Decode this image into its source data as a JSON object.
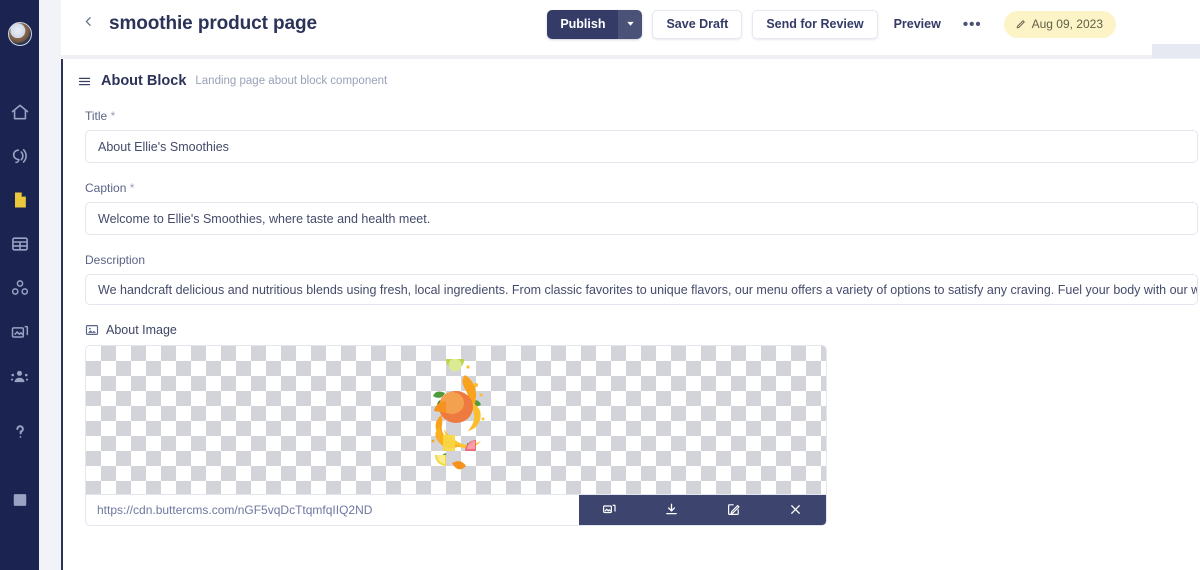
{
  "sidebar": {
    "avatar": {
      "name": "user-avatar"
    },
    "items": [
      {
        "icon": "home-icon",
        "name": "sidebar-item-home",
        "active": false
      },
      {
        "icon": "megaphone-icon",
        "name": "sidebar-item-broadcast",
        "active": false
      },
      {
        "icon": "page-icon",
        "name": "sidebar-item-pages",
        "active": true
      },
      {
        "icon": "table-icon",
        "name": "sidebar-item-collections",
        "active": false
      },
      {
        "icon": "components-icon",
        "name": "sidebar-item-components",
        "active": false
      },
      {
        "icon": "media-icon",
        "name": "sidebar-item-media",
        "active": false
      },
      {
        "icon": "team-icon",
        "name": "sidebar-item-team",
        "active": false
      }
    ],
    "bottom_items": [
      {
        "icon": "help-icon",
        "name": "sidebar-item-help"
      },
      {
        "icon": "book-icon",
        "name": "sidebar-item-docs"
      }
    ]
  },
  "header": {
    "back_label": "‹",
    "title": "smoothie product page",
    "publish_label": "Publish",
    "publish_caret": "▾",
    "save_draft_label": "Save Draft",
    "send_for_review_label": "Send for Review",
    "preview_label": "Preview",
    "more_label": "•••",
    "date_badge": "Aug 09, 2023"
  },
  "block": {
    "title": "About Block",
    "subtitle": "Landing page about block component",
    "fields": {
      "title": {
        "label": "Title",
        "required": "*",
        "value": "About Ellie's Smoothies"
      },
      "caption": {
        "label": "Caption",
        "required": "*",
        "value": "Welcome to Ellie's Smoothies, where taste and health meet."
      },
      "description": {
        "label": "Description",
        "required": "",
        "value": "We handcraft delicious and nutritious blends using fresh, local ingredients. From classic favorites to unique flavors, our menu offers a variety of options to satisfy any craving. Fuel your body with our wholesome smoothies."
      },
      "about_image": {
        "label": "About Image",
        "url": "https://cdn.buttercms.com/nGF5vqDcTtqmfqIIQ2ND",
        "toolbar": [
          {
            "name": "replace-image-button",
            "icon": "images-icon"
          },
          {
            "name": "download-image-button",
            "icon": "download-icon"
          },
          {
            "name": "edit-image-button",
            "icon": "edit-square-icon"
          },
          {
            "name": "remove-image-button",
            "icon": "close-icon"
          }
        ]
      }
    }
  },
  "colors": {
    "sidebar_bg": "#1b2350",
    "accent_dark": "#2c3358",
    "publish_bg": "#333b66",
    "publish_caret_bg": "#4a5278",
    "date_badge_bg": "#fcf3c6",
    "toolbar_bg": "#3d456e",
    "active_icon": "#ecc93c",
    "border": "#e3e6ef"
  }
}
